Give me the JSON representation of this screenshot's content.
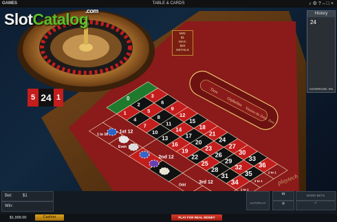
{
  "top_bar": {
    "games_label": "GAMES",
    "category_label": "TABLE & CARDS",
    "system_icons": [
      "volume-icon",
      "settings-icon",
      "help-icon",
      "minimize-icon",
      "maximize-icon",
      "close-icon"
    ]
  },
  "watermark": {
    "part1": "Slot",
    "part2": "Catalog",
    "suffix": ".com",
    "colors": {
      "part1": "#f2f2f2",
      "part2": "#5bbf2a"
    }
  },
  "history": {
    "title": "History",
    "numbers": [
      "24"
    ],
    "coverage_label": "COVERAGE: 0%"
  },
  "bet_limits": {
    "min_label": "MIN:",
    "min_value": "$1",
    "max_label": "MAX:",
    "max_value": "$20",
    "details_label": "DETAILS"
  },
  "last_results": [
    {
      "number": "5",
      "color": "#c31d1d"
    },
    {
      "number": "24",
      "color": "#111111"
    },
    {
      "number": "1",
      "color": "#c31d1d"
    }
  ],
  "roulette_table": {
    "felt_color": "#8b1a1a",
    "zero": "0",
    "rows": [
      [
        "3",
        "6",
        "9",
        "12",
        "15",
        "18",
        "21",
        "24",
        "27",
        "30",
        "33",
        "36"
      ],
      [
        "2",
        "5",
        "8",
        "11",
        "14",
        "17",
        "20",
        "23",
        "26",
        "29",
        "32",
        "35"
      ],
      [
        "1",
        "4",
        "7",
        "10",
        "13",
        "16",
        "19",
        "22",
        "25",
        "28",
        "31",
        "34"
      ]
    ],
    "red_numbers": [
      "1",
      "3",
      "5",
      "7",
      "9",
      "12",
      "14",
      "16",
      "18",
      "19",
      "21",
      "23",
      "25",
      "27",
      "30",
      "32",
      "34",
      "36"
    ],
    "column_bets": [
      "2 to 1",
      "2 to 1",
      "2 to 1"
    ],
    "dozens": [
      "1st 12",
      "2nd 12",
      "3rd 12"
    ],
    "outside_bets": [
      "1 to 18",
      "Even",
      "",
      "",
      "Odd",
      "19 to 36"
    ],
    "racetrack_labels": [
      "Tiers",
      "Orphelins",
      "Voisins du Zero",
      "Zero"
    ],
    "brand": "playtech"
  },
  "chips": [
    {
      "color": "#2b63c9"
    },
    {
      "color": "#e7e7e7"
    },
    {
      "color": "#dcdcdc"
    },
    {
      "color": "#3a63c8"
    },
    {
      "color": "#6a3fb0"
    },
    {
      "color": "#e9e3d2"
    }
  ],
  "bet_panel": {
    "bet_label": "Bet:",
    "bet_value": "$1",
    "win_label": "Win:",
    "win_value": ""
  },
  "controls": {
    "autoplay_label": "AUTOPLAY",
    "more_bets_label": "MORE BETS"
  },
  "footer": {
    "balance": "$1,999.00",
    "cashier_label": "Cashier",
    "real_money_label": "PLAY FOR REAL MONEY"
  }
}
